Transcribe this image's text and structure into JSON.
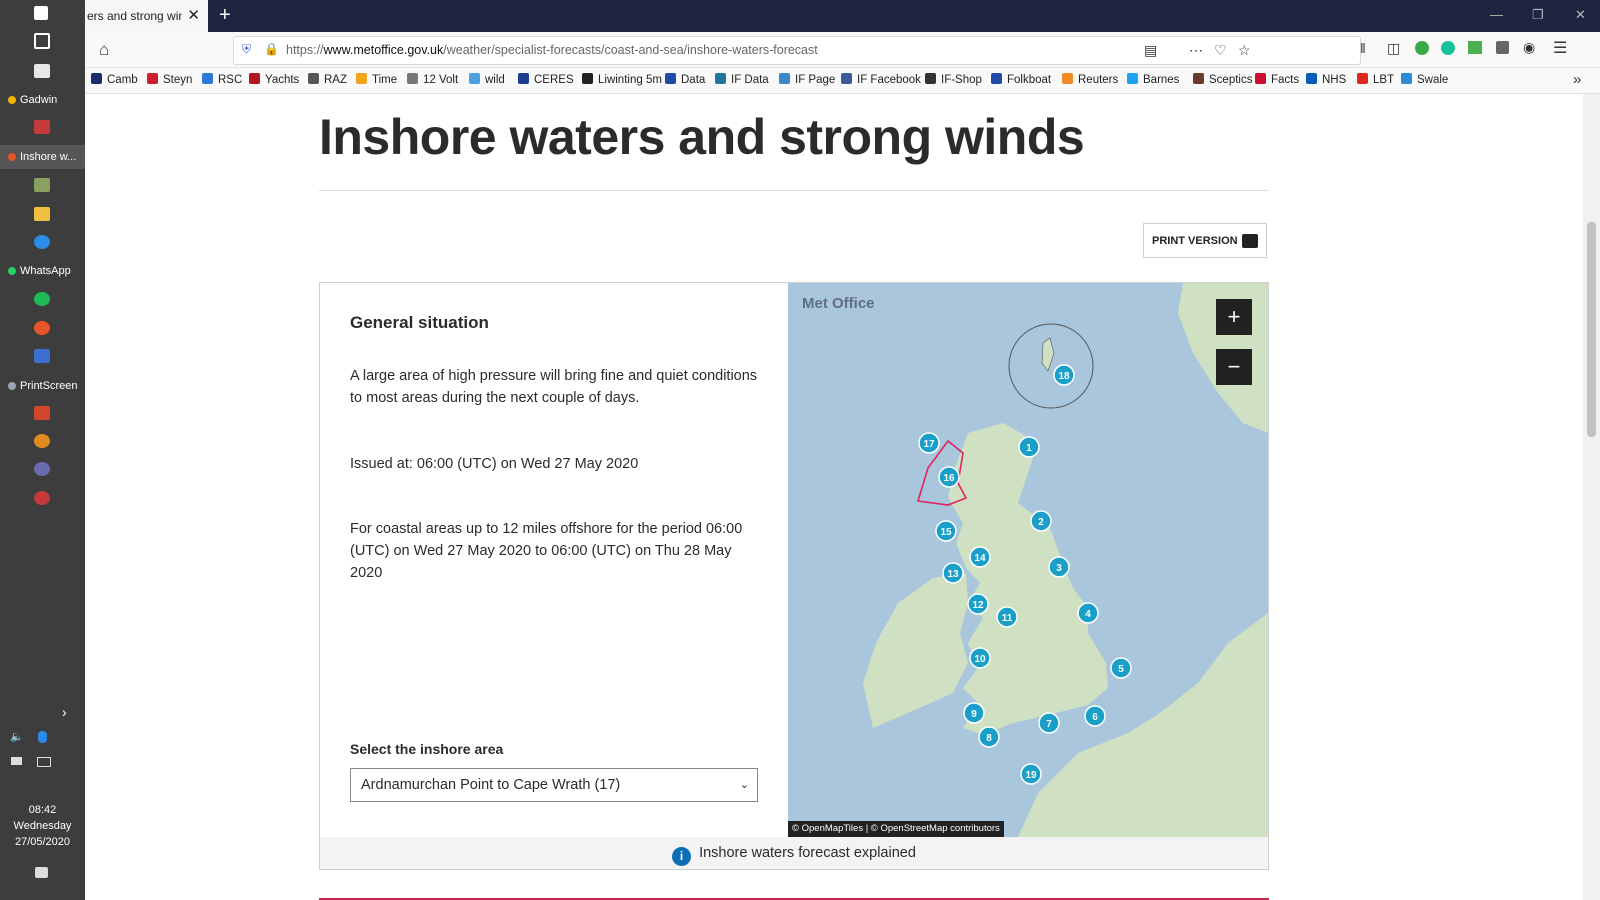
{
  "taskbar": {
    "apps": [
      {
        "label": "Gadwin",
        "color": "#f0b400"
      },
      {
        "label": "Inshore w...",
        "color": "#e0542a"
      },
      {
        "label": "WhatsApp",
        "color": "#25d366"
      },
      {
        "label": "PrintScreen",
        "color": "#9aa4b5"
      }
    ],
    "clock": {
      "time": "08:42",
      "day": "Wednesday",
      "date": "27/05/2020"
    }
  },
  "browser": {
    "tab_title": "ers and strong winds",
    "url_domain": "www.metoffice.gov.uk",
    "url_prefix": "https://",
    "url_path": "/weather/specialist-forecasts/coast-and-sea/inshore-waters-forecast",
    "bookmarks": [
      {
        "label": "Camb",
        "color": "#1c2d6b"
      },
      {
        "label": "Steyn",
        "color": "#cc1f2e"
      },
      {
        "label": "RSC",
        "color": "#2a7ad6"
      },
      {
        "label": "Yachts",
        "color": "#b0161c"
      },
      {
        "label": "RAZ",
        "color": "#555555"
      },
      {
        "label": "Time",
        "color": "#f2a41c"
      },
      {
        "label": "12 Volt",
        "color": "#777777"
      },
      {
        "label": "wild",
        "color": "#4da0e0"
      },
      {
        "label": "CERES",
        "color": "#1b3f8e"
      },
      {
        "label": "Liwinting 5m",
        "color": "#222222"
      },
      {
        "label": "Data",
        "color": "#1f4aa8"
      },
      {
        "label": "IF Data",
        "color": "#21759b"
      },
      {
        "label": "IF Page",
        "color": "#3a88c8"
      },
      {
        "label": "IF Facebook",
        "color": "#3b5998"
      },
      {
        "label": "IF-Shop",
        "color": "#333333"
      },
      {
        "label": "Folkboat",
        "color": "#1f4aa8"
      },
      {
        "label": "Reuters",
        "color": "#f08a24"
      },
      {
        "label": "Barnes",
        "color": "#1da1f2"
      },
      {
        "label": "Sceptics",
        "color": "#6b3b2a"
      },
      {
        "label": "Facts",
        "color": "#c8102e"
      },
      {
        "label": "NHS",
        "color": "#005eb8"
      },
      {
        "label": "LBT",
        "color": "#e1261c"
      },
      {
        "label": "Swale",
        "color": "#2a8ad6"
      }
    ]
  },
  "page": {
    "title": "Inshore waters and strong winds",
    "print_label": "PRINT VERSION",
    "panel": {
      "heading": "General situation",
      "situation": "A large area of high pressure will bring fine and quiet conditions to most areas during the next couple of days.",
      "issued": "Issued at: 06:00 (UTC) on Wed 27 May 2020",
      "period": "For coastal areas up to 12 miles offshore for the period 06:00 (UTC) on Wed 27 May 2020 to 06:00 (UTC) on Thu 28 May 2020",
      "select_label": "Select the inshore area",
      "select_value": "Ardnamurchan Point to Cape Wrath (17)",
      "explained_link": "Inshore waters forecast explained"
    },
    "map": {
      "brand": "Met Office",
      "attribution": "© OpenMapTiles | © OpenStreetMap contributors",
      "zoom_in": "+",
      "zoom_out": "−",
      "area_markers": [
        "1",
        "2",
        "3",
        "4",
        "5",
        "6",
        "7",
        "8",
        "9",
        "10",
        "11",
        "12",
        "13",
        "14",
        "15",
        "16",
        "17",
        "18",
        "19"
      ],
      "selected_area": "17",
      "colors": {
        "sea": "#a9c6dc",
        "land": "#cfe0c3",
        "marker": "#1aa0c8",
        "selected_outline": "#e0245e"
      }
    }
  }
}
